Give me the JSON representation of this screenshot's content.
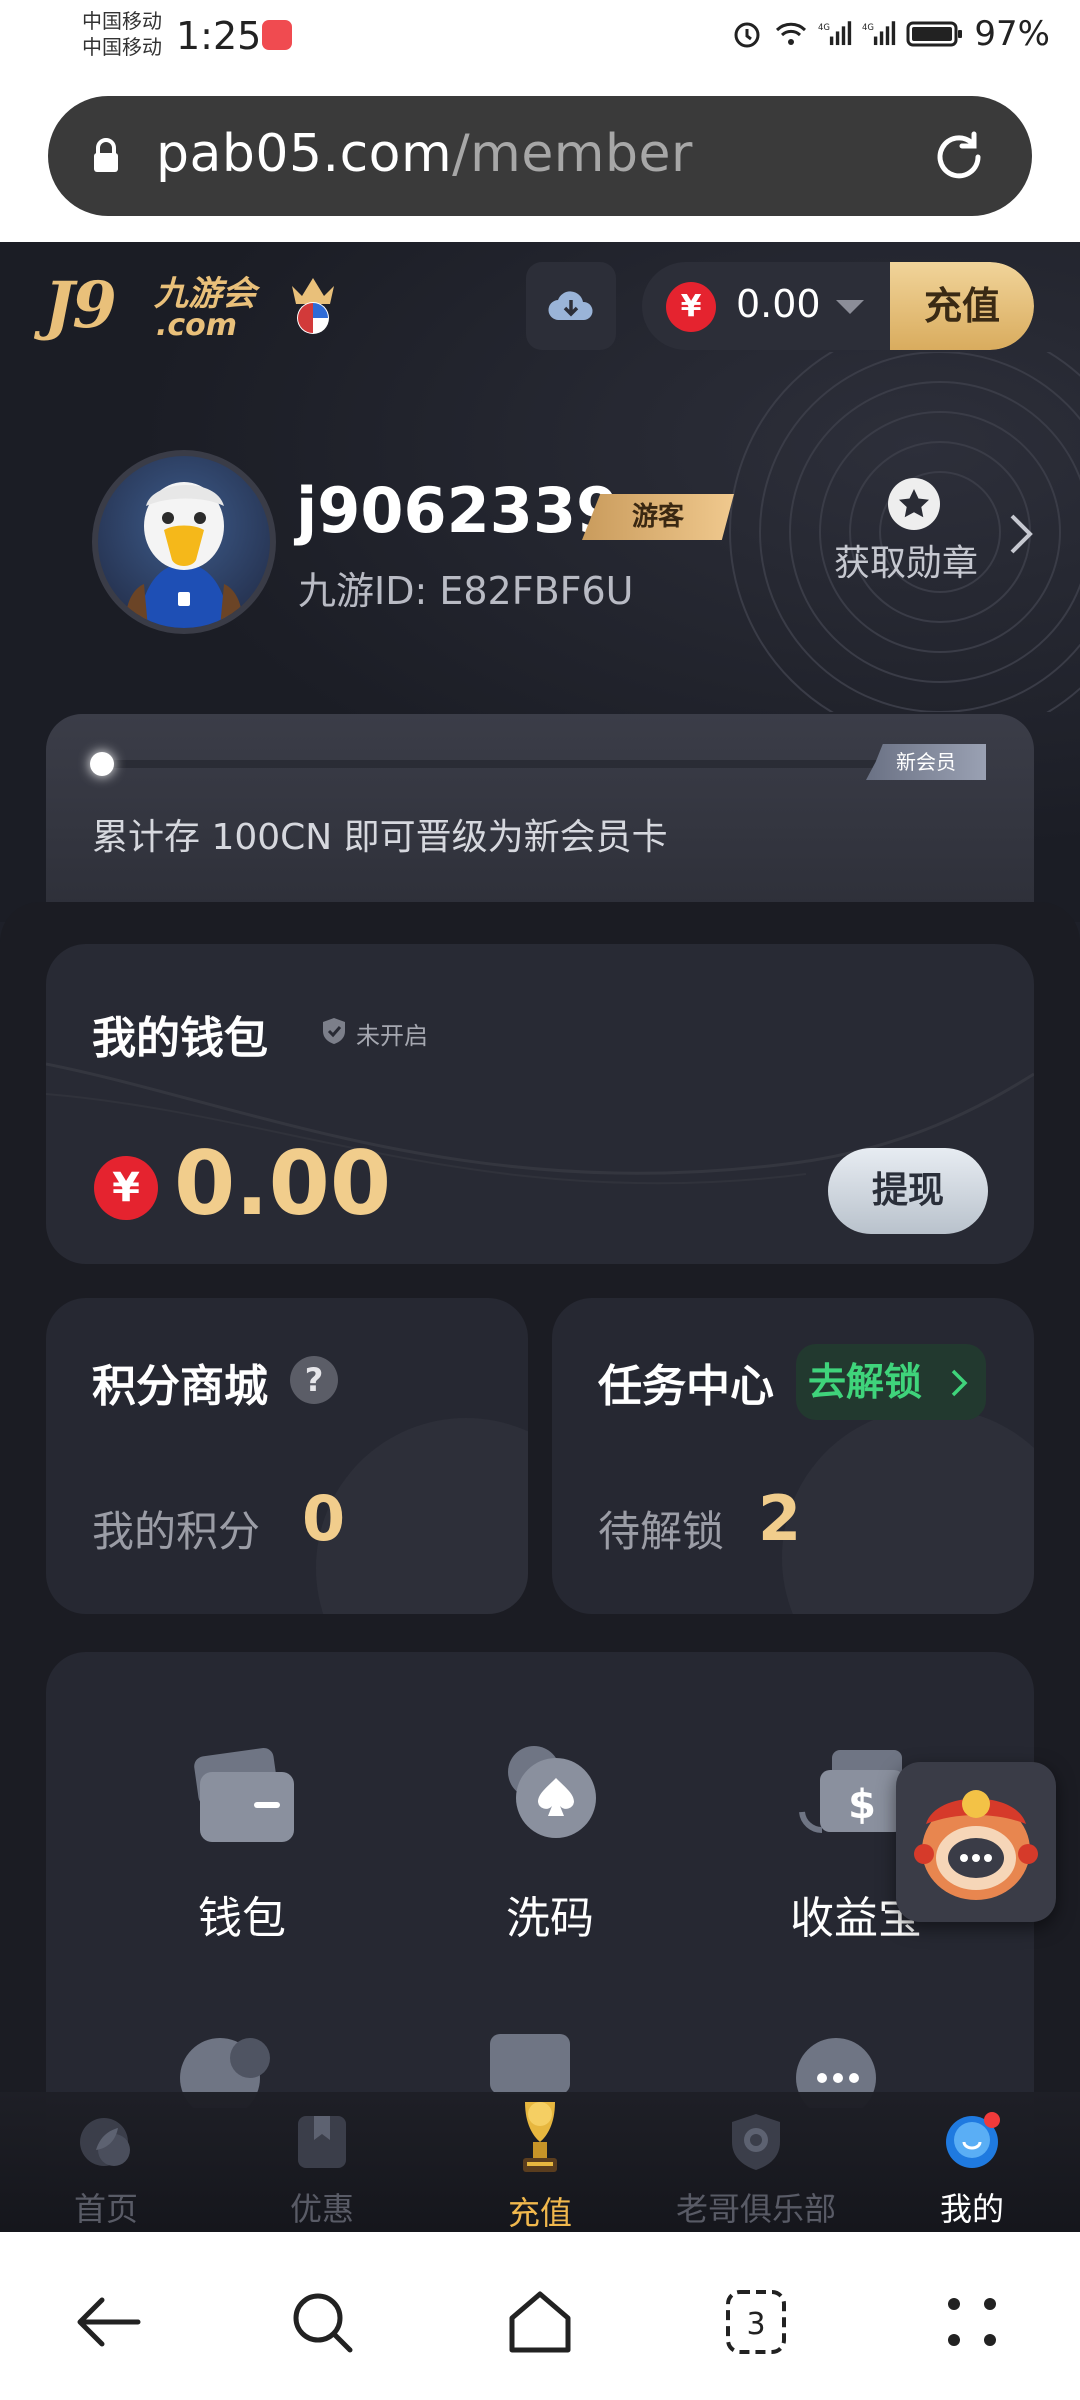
{
  "status_bar": {
    "carrier_1": "中国移动",
    "carrier_2": "中国移动",
    "time": "1:25",
    "battery": "97%",
    "icons": [
      "alarm-icon",
      "wifi-icon",
      "signal-4g-icon",
      "signal-4g-icon",
      "battery-icon"
    ]
  },
  "browser": {
    "url_domain": "pab05.com",
    "url_path": "/member"
  },
  "header": {
    "logo_text_j9": "J9",
    "logo_text_cn": "九游会",
    "logo_text_com": ".com",
    "currency_symbol": "¥",
    "balance": "0.00",
    "recharge_label": "充值"
  },
  "profile": {
    "username": "j9062339",
    "tag": "游客",
    "member_id": "九游ID: E82FBF6U",
    "medal_label": "获取勋章"
  },
  "level": {
    "badge": "新会员",
    "progress": 0,
    "hint": "累计存 100CN 即可晋级为新会员卡"
  },
  "wallet": {
    "title": "我的钱包",
    "status": "未开启",
    "currency_symbol": "¥",
    "amount": "0.00",
    "withdraw_label": "提现"
  },
  "points_mall": {
    "title": "积分商城",
    "help": "?",
    "sub_label": "我的积分",
    "value": "0"
  },
  "task_center": {
    "title": "任务中心",
    "unlock_label": "去解锁",
    "sub_label": "待解锁",
    "value": "2"
  },
  "services": [
    {
      "label": "钱包",
      "icon": "wallet-icon"
    },
    {
      "label": "洗码",
      "icon": "spade-chip-icon"
    },
    {
      "label": "收益宝",
      "icon": "dollar-card-icon"
    }
  ],
  "tabs": [
    {
      "label": "首页",
      "icon": "home-leaf-icon"
    },
    {
      "label": "优惠",
      "icon": "gift-bookmark-icon"
    },
    {
      "label": "充值",
      "icon": "trophy-icon"
    },
    {
      "label": "老哥俱乐部",
      "icon": "club-shield-icon"
    },
    {
      "label": "我的",
      "icon": "profile-icon"
    }
  ],
  "colors": {
    "accent_gold": "#f1cd8c",
    "brand_red": "#e5232f",
    "active_tab": "#f1b84d",
    "unlock_green": "#3fd47b",
    "app_bg": "#1e2029"
  }
}
